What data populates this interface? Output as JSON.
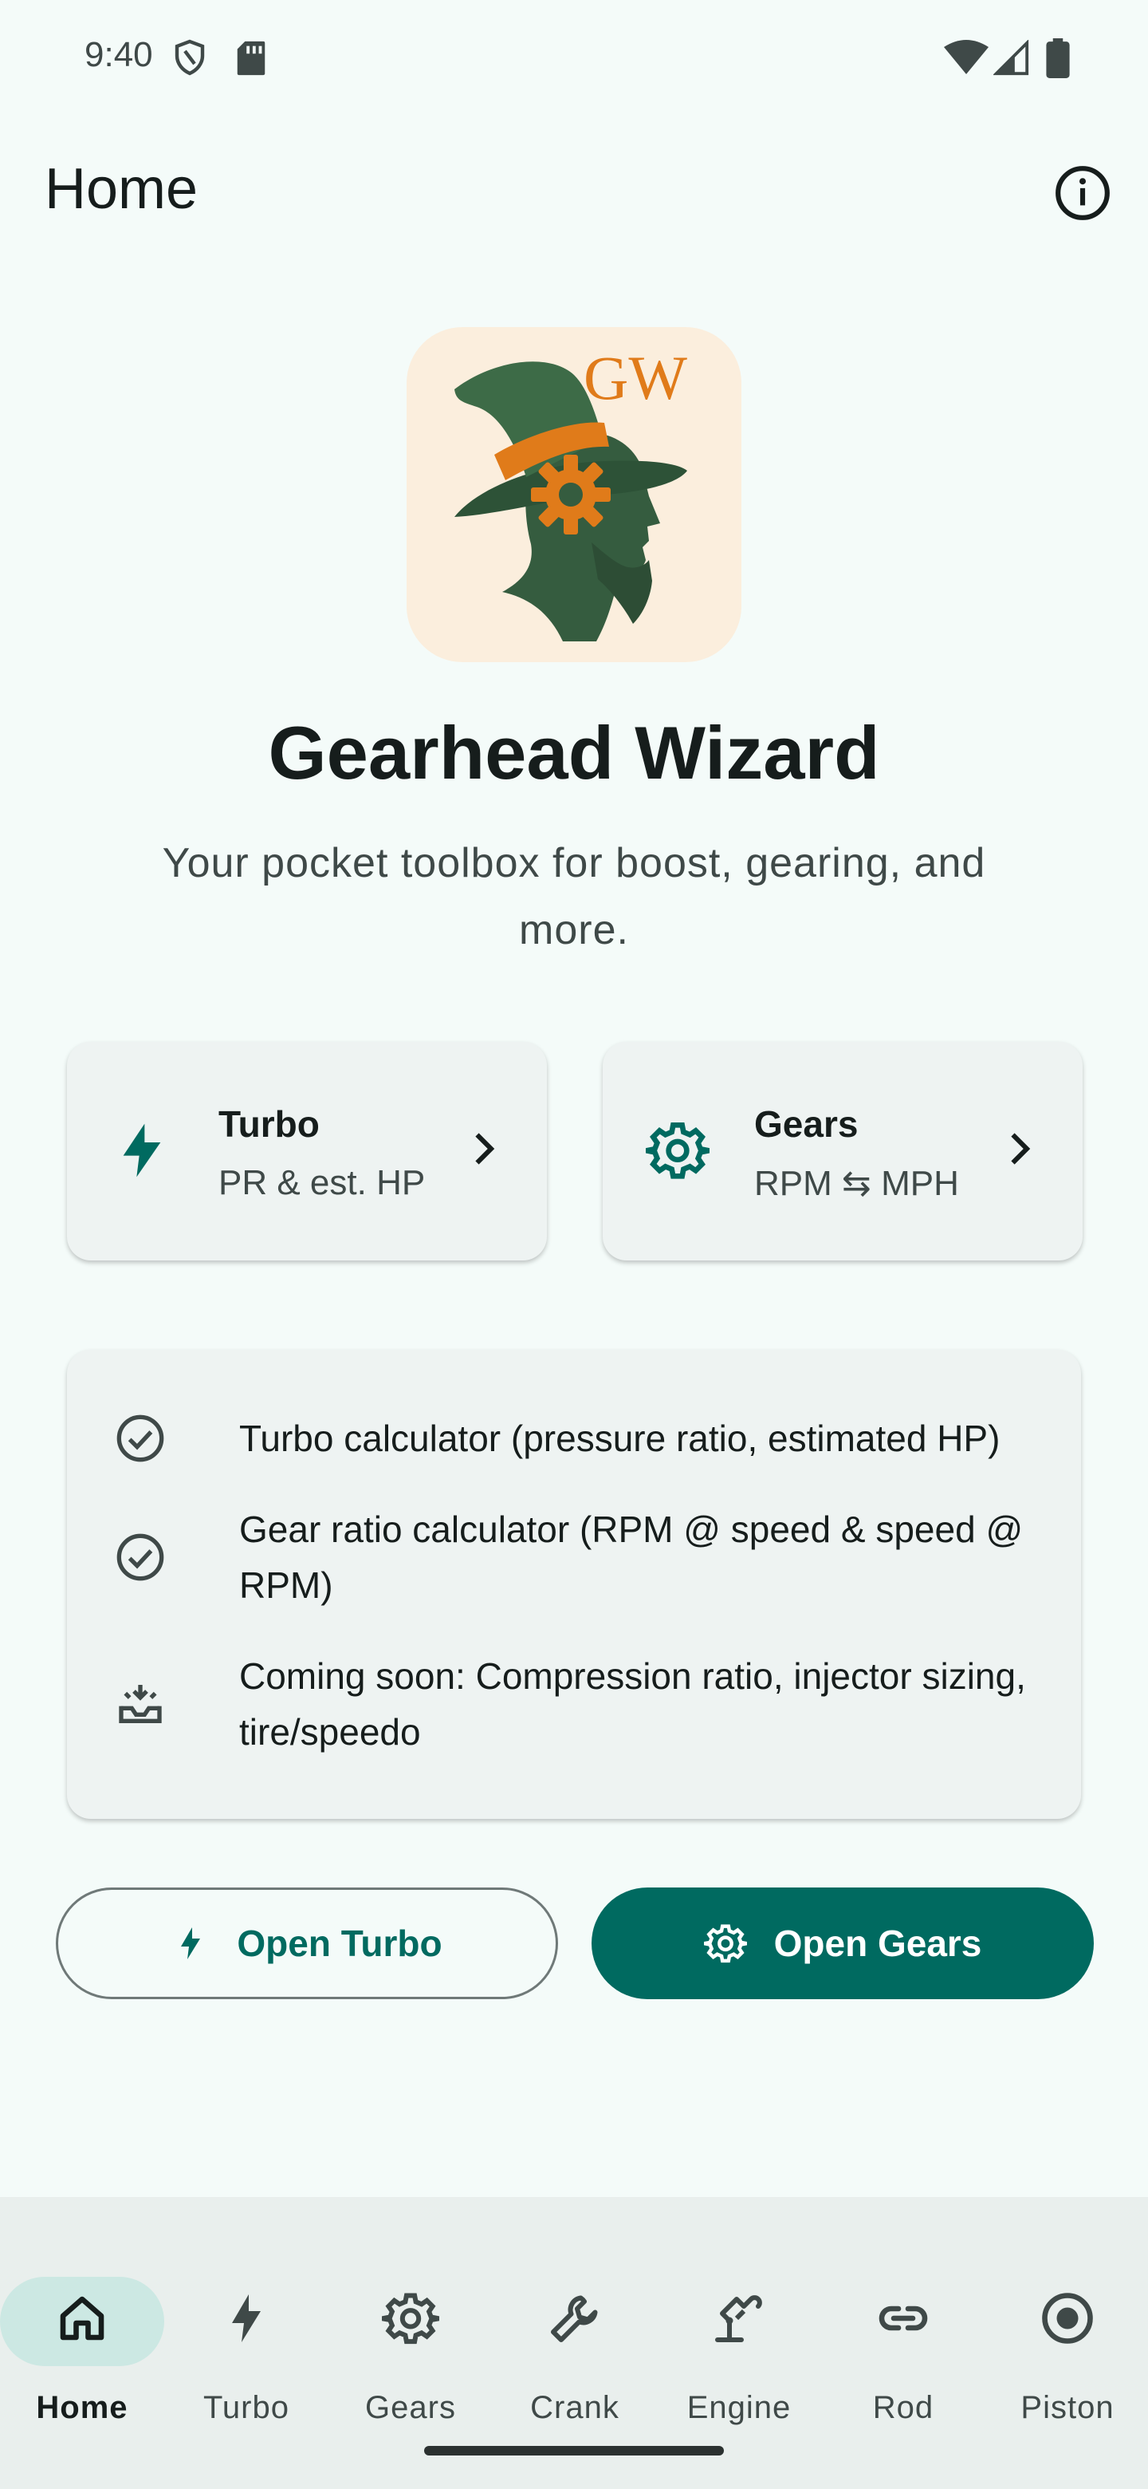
{
  "status_bar": {
    "time": "9:40",
    "icons": [
      "shield-icon",
      "sd-card-icon",
      "wifi-icon",
      "signal-icon",
      "battery-icon"
    ]
  },
  "top_bar": {
    "title": "Home",
    "info_icon": "info-icon"
  },
  "hero": {
    "logo_text": "GW",
    "app_name": "Gearhead Wizard",
    "tagline": "Your pocket toolbox for boost, gearing, and more."
  },
  "cards": [
    {
      "title": "Turbo",
      "subtitle": "PR & est. HP",
      "icon": "bolt-icon"
    },
    {
      "title": "Gears",
      "subtitle": "RPM ⇆ MPH",
      "icon": "gear-icon"
    }
  ],
  "features": [
    {
      "text": "Turbo calculator (pressure ratio, estimated HP)",
      "icon": "check-circle-icon"
    },
    {
      "text": "Gear ratio calculator (RPM @ speed & speed @ RPM)",
      "icon": "check-circle-icon"
    },
    {
      "text": "Coming soon: Compression ratio, injector sizing, tire/speedo",
      "icon": "inbox-icon"
    }
  ],
  "buttons": {
    "open_turbo": "Open Turbo",
    "open_gears": "Open Gears"
  },
  "bottom_nav": {
    "active": "Home",
    "items": [
      {
        "label": "Home",
        "icon": "home-icon"
      },
      {
        "label": "Turbo",
        "icon": "bolt-icon"
      },
      {
        "label": "Gears",
        "icon": "gear-icon"
      },
      {
        "label": "Crank",
        "icon": "wrench-icon"
      },
      {
        "label": "Engine",
        "icon": "engine-icon"
      },
      {
        "label": "Rod",
        "icon": "link-icon"
      },
      {
        "label": "Piston",
        "icon": "piston-icon"
      }
    ]
  },
  "colors": {
    "primary": "#006a60",
    "background": "#f4fbf9",
    "surface_card": "#eef3f2",
    "nav_background": "#e9efed",
    "nav_active_pill": "#cce8e3",
    "logo_background": "#fbeedd",
    "logo_orange": "#e07b1a",
    "logo_green": "#355c3f"
  }
}
